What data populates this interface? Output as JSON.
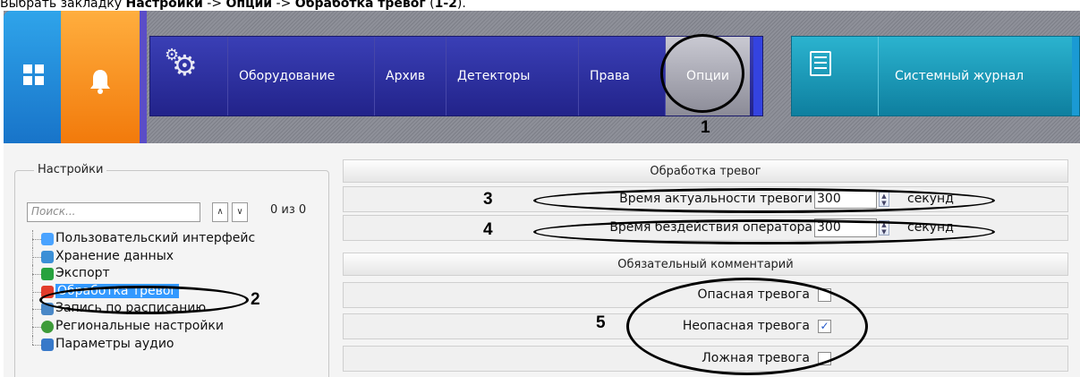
{
  "caption": {
    "prefix": "Выбрать закладку ",
    "bold1": "Настройки",
    "sep1": " -> ",
    "bold2": "Опции",
    "sep2": " -> ",
    "bold3": "Обработка тревог",
    "suffix_open": " (",
    "bold4": "1-2",
    "suffix_close": ")."
  },
  "top": {
    "tiles": [
      {
        "name": "windows",
        "icon": "windows-grid-icon",
        "color": "#1f8adb"
      },
      {
        "name": "alarm",
        "icon": "bell-icon",
        "color": "#f58b1e"
      }
    ],
    "nav_icon": "gears-icon",
    "nav": [
      "Оборудование",
      "Архив",
      "Детекторы",
      "Права",
      "Опции"
    ],
    "selected": "Опции",
    "sys_icon": "checklist-icon",
    "sys_label": "Системный журнал"
  },
  "annotations": {
    "n1": "1",
    "n2": "2",
    "n3": "3",
    "n4": "4",
    "n5": "5"
  },
  "settings": {
    "group_title": "Настройки",
    "search_placeholder": "Поиск...",
    "up_arrow": "∧",
    "down_arrow": "∨",
    "counter": "0 из 0",
    "tree": [
      {
        "label": "Пользовательский интерфейс",
        "icon": "monitor-icon",
        "color": "#4aa3ff"
      },
      {
        "label": "Хранение данных",
        "icon": "database-icon",
        "color": "#3b8fd6"
      },
      {
        "label": "Экспорт",
        "icon": "export-icon",
        "color": "#27a23e"
      },
      {
        "label": "Обработка тревог",
        "icon": "alarm-icon",
        "color": "#e23c2b",
        "selected": true
      },
      {
        "label": "Запись по расписанию",
        "icon": "schedule-icon",
        "color": "#4a88c7"
      },
      {
        "label": "Региональные настройки",
        "icon": "globe-icon",
        "color": "#3e9b3a"
      },
      {
        "label": "Параметры аудио",
        "icon": "audio-icon",
        "color": "#3879c9"
      }
    ]
  },
  "alarm": {
    "section_title": "Обработка тревог",
    "rows": [
      {
        "label": "Время актуальности тревоги",
        "value": "300",
        "unit": "секунд"
      },
      {
        "label": "Время бездействия оператора",
        "value": "300",
        "unit": "секунд"
      }
    ],
    "comment_title": "Обязательный комментарий",
    "checks": [
      {
        "label": "Опасная тревога",
        "checked": false
      },
      {
        "label": "Неопасная тревога",
        "checked": true
      },
      {
        "label": "Ложная тревога",
        "checked": false
      }
    ]
  }
}
